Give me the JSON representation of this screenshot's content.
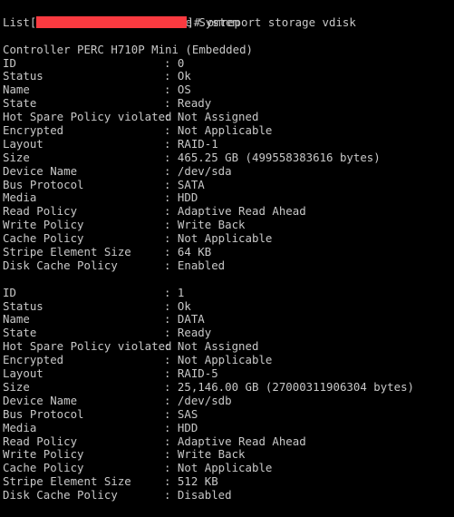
{
  "terminal": {
    "background_color": "#000000",
    "text_color": "#c8c8c8",
    "redaction_color": "#fa3a40",
    "prompt": {
      "open_bracket": "[",
      "redacted_user_host": "",
      "close_bracket_hash": "]# ",
      "command": "omreport storage vdisk"
    },
    "output_header": "List of Virtual Disks in the System",
    "controller_header": "Controller PERC H710P Mini (Embedded)",
    "separator": ":",
    "vdisks": [
      {
        "fields": [
          {
            "key": "ID",
            "value": "0"
          },
          {
            "key": "Status",
            "value": "Ok"
          },
          {
            "key": "Name",
            "value": "OS"
          },
          {
            "key": "State",
            "value": "Ready"
          },
          {
            "key": "Hot Spare Policy violated",
            "value": "Not Assigned"
          },
          {
            "key": "Encrypted",
            "value": "Not Applicable"
          },
          {
            "key": "Layout",
            "value": "RAID-1"
          },
          {
            "key": "Size",
            "value": "465.25 GB (499558383616 bytes)"
          },
          {
            "key": "Device Name",
            "value": "/dev/sda"
          },
          {
            "key": "Bus Protocol",
            "value": "SATA"
          },
          {
            "key": "Media",
            "value": "HDD"
          },
          {
            "key": "Read Policy",
            "value": "Adaptive Read Ahead"
          },
          {
            "key": "Write Policy",
            "value": "Write Back"
          },
          {
            "key": "Cache Policy",
            "value": "Not Applicable"
          },
          {
            "key": "Stripe Element Size",
            "value": "64 KB"
          },
          {
            "key": "Disk Cache Policy",
            "value": "Enabled"
          }
        ]
      },
      {
        "fields": [
          {
            "key": "ID",
            "value": "1"
          },
          {
            "key": "Status",
            "value": "Ok"
          },
          {
            "key": "Name",
            "value": "DATA"
          },
          {
            "key": "State",
            "value": "Ready"
          },
          {
            "key": "Hot Spare Policy violated",
            "value": "Not Assigned"
          },
          {
            "key": "Encrypted",
            "value": "Not Applicable"
          },
          {
            "key": "Layout",
            "value": "RAID-5"
          },
          {
            "key": "Size",
            "value": "25,146.00 GB (27000311906304 bytes)"
          },
          {
            "key": "Device Name",
            "value": "/dev/sdb"
          },
          {
            "key": "Bus Protocol",
            "value": "SAS"
          },
          {
            "key": "Media",
            "value": "HDD"
          },
          {
            "key": "Read Policy",
            "value": "Adaptive Read Ahead"
          },
          {
            "key": "Write Policy",
            "value": "Write Back"
          },
          {
            "key": "Cache Policy",
            "value": "Not Applicable"
          },
          {
            "key": "Stripe Element Size",
            "value": "512 KB"
          },
          {
            "key": "Disk Cache Policy",
            "value": "Disabled"
          }
        ]
      }
    ]
  }
}
